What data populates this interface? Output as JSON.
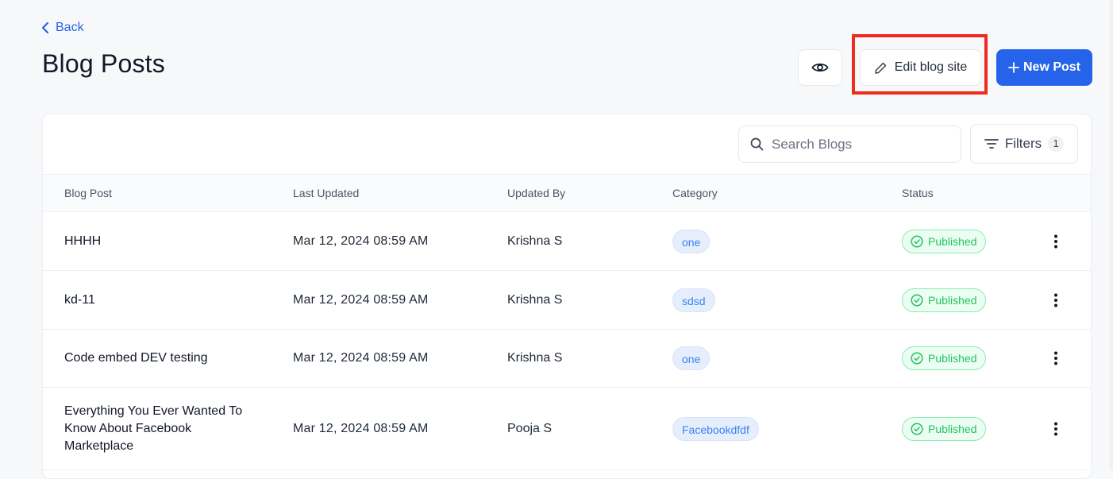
{
  "nav": {
    "back_label": "Back"
  },
  "page": {
    "title": "Blog Posts"
  },
  "toolbar": {
    "preview_icon": "eye-icon",
    "edit_label": "Edit blog site",
    "edit_icon": "pencil-icon",
    "new_post_label": "New Post",
    "new_post_icon": "plus-icon"
  },
  "search": {
    "placeholder": "Search Blogs",
    "value": ""
  },
  "filters": {
    "label": "Filters",
    "count": "1"
  },
  "table": {
    "columns": [
      "Blog Post",
      "Last Updated",
      "Updated By",
      "Category",
      "Status"
    ],
    "rows": [
      {
        "title": "HHHH",
        "updated": "Mar 12, 2024 08:59 AM",
        "by": "Krishna S",
        "category": "one",
        "status": "Published"
      },
      {
        "title": "kd-11",
        "updated": "Mar 12, 2024 08:59 AM",
        "by": "Krishna S",
        "category": "sdsd",
        "status": "Published"
      },
      {
        "title": "Code embed DEV testing",
        "updated": "Mar 12, 2024 08:59 AM",
        "by": "Krishna S",
        "category": "one",
        "status": "Published"
      },
      {
        "title": "Everything You Ever Wanted To Know About Facebook Marketplace",
        "updated": "Mar 12, 2024 08:59 AM",
        "by": "Pooja S",
        "category": "Facebookdfdf",
        "status": "Published"
      }
    ]
  },
  "colors": {
    "accent": "#2563eb",
    "highlight": "#ef2b1e",
    "published": "#22c55e",
    "category_chip": "#e6eefb"
  }
}
